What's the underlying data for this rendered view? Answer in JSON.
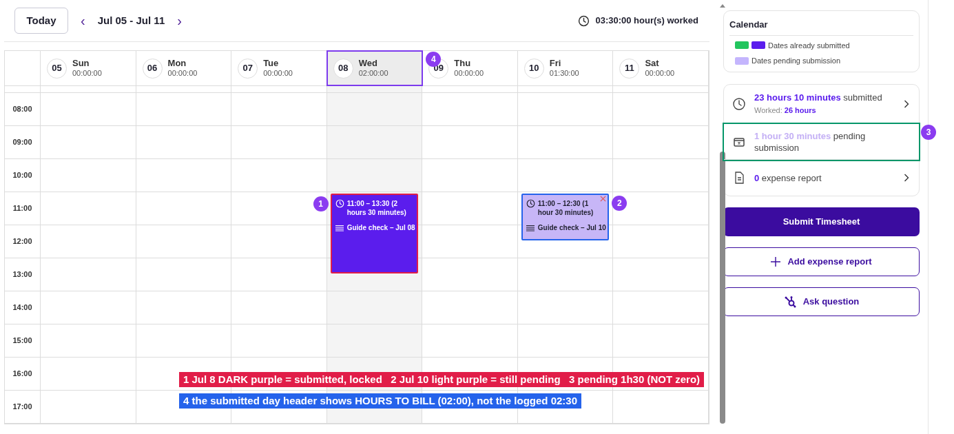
{
  "toolbar": {
    "today": "Today",
    "prev": "‹",
    "next": "›",
    "range": "Jul 05 - Jul 11",
    "worked": "03:30:00 hour(s) worked"
  },
  "days": [
    {
      "number": "05",
      "name": "Sun",
      "total": "00:00:00",
      "selected": false
    },
    {
      "number": "06",
      "name": "Mon",
      "total": "00:00:00",
      "selected": false
    },
    {
      "number": "07",
      "name": "Tue",
      "total": "00:00:00",
      "selected": false
    },
    {
      "number": "08",
      "name": "Wed",
      "total": "02:00:00",
      "selected": true,
      "color": "#7c3aed",
      "badge": "4",
      "events": [
        {
          "kind": "submitted",
          "time": "11:00 – 13:30 (2 hours 30 minutes)",
          "title": "Guide check – Jul 08",
          "color": "#e11d48",
          "badge": "1"
        }
      ]
    },
    {
      "number": "09",
      "name": "Thu",
      "total": "00:00:00",
      "selected": false
    },
    {
      "number": "10",
      "name": "Fri",
      "total": "01:30:00",
      "selected": false,
      "events": [
        {
          "kind": "pending",
          "time": "11:00 – 12:30 (1 hour 30 minutes)",
          "title": "Guide check – Jul 10",
          "color": "#2563eb",
          "badge": "2"
        }
      ]
    },
    {
      "number": "11",
      "name": "Sat",
      "total": "00:00:00",
      "selected": false
    }
  ],
  "times": [
    "08:00",
    "09:00",
    "10:00",
    "11:00",
    "12:00",
    "13:00",
    "14:00",
    "15:00",
    "16:00",
    "17:00"
  ],
  "legend": {
    "title": "Calendar",
    "items": [
      {
        "swatches": [
          {
            "color": "#22c55e"
          },
          {
            "color": "#5b1ded"
          }
        ],
        "label": "Dates already submitted"
      },
      {
        "swatches": [
          {
            "color": "#c4b5fd"
          }
        ],
        "label": "Dates pending submission"
      }
    ]
  },
  "summary": [
    {
      "kind": "submitted",
      "highlight": "23 hours 10 minutes",
      "text": "submitted",
      "sub_label": "Worked:",
      "sub_value": "26 hours",
      "chevron": true
    },
    {
      "kind": "pending",
      "highlight": "1 hour 30 minutes",
      "text": "pending submission",
      "chevron": false,
      "color": "#059669",
      "badge": "3"
    },
    {
      "kind": "expense",
      "highlight": "0",
      "text": "expense report",
      "chevron": true
    }
  ],
  "buttons": [
    {
      "kind": "primary",
      "label": "Submit Timesheet"
    },
    {
      "kind": "add",
      "label": "Add expense report"
    },
    {
      "kind": "ask",
      "label": "Ask question"
    }
  ],
  "captions": [
    {
      "color": "#e11d48",
      "text": "1 Jul 8 DARK purple = submitted, locked   2 Jul 10 light purple = still pending   3 pending 1h30 (NOT zero)"
    },
    {
      "color": "#2563eb",
      "text": "4 the submitted day header shows HOURS TO BILL (02:00), not the logged 02:30"
    }
  ]
}
